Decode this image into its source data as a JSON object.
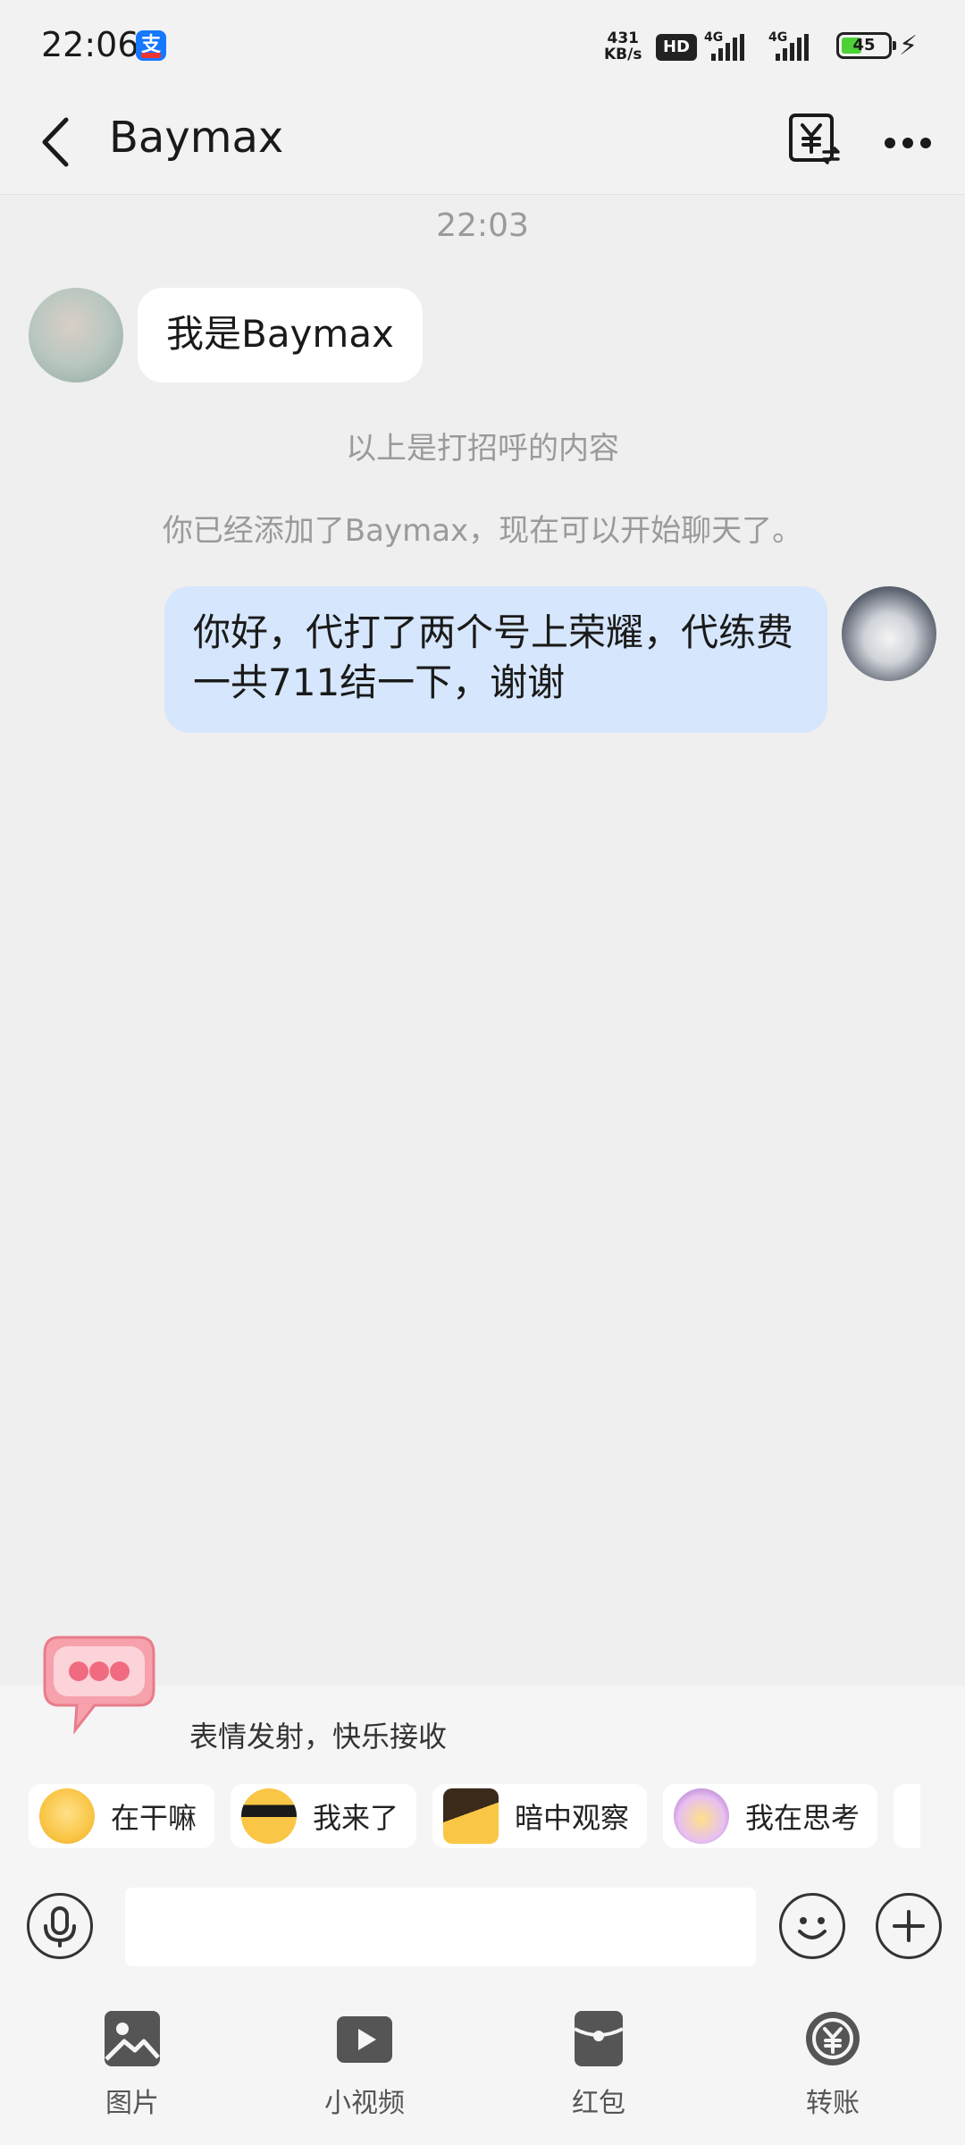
{
  "status_bar": {
    "time": "22:06",
    "net_speed_value": "431",
    "net_speed_unit": "KB/s",
    "hd_label": "HD",
    "signal_1": "4G",
    "signal_2": "4G",
    "battery_level": "45"
  },
  "header": {
    "title": "Baymax"
  },
  "chat": {
    "timestamp": "22:03",
    "messages": [
      {
        "side": "left",
        "text": "我是Baymax"
      },
      {
        "side": "right",
        "text": "你好，代打了两个号上荣耀，代练费一共711结一下，谢谢"
      }
    ],
    "system_messages": [
      "以上是打招呼的内容",
      "你已经添加了Baymax，现在可以开始聊天了。"
    ]
  },
  "emoji_panel": {
    "title": "表情发射，快乐接收",
    "chips": [
      {
        "label": "在干嘛"
      },
      {
        "label": "我来了"
      },
      {
        "label": "暗中观察"
      },
      {
        "label": "我在思考"
      }
    ]
  },
  "input": {
    "value": "",
    "placeholder": ""
  },
  "toolbar": {
    "items": [
      {
        "label": "图片",
        "icon": "image-icon"
      },
      {
        "label": "小视频",
        "icon": "video-icon"
      },
      {
        "label": "红包",
        "icon": "red-envelope-icon"
      },
      {
        "label": "转账",
        "icon": "transfer-icon"
      }
    ]
  },
  "colors": {
    "background": "#efefef",
    "outgoing_bubble": "#d6e6fc",
    "incoming_bubble": "#ffffff",
    "battery_fill": "#4cd137"
  }
}
